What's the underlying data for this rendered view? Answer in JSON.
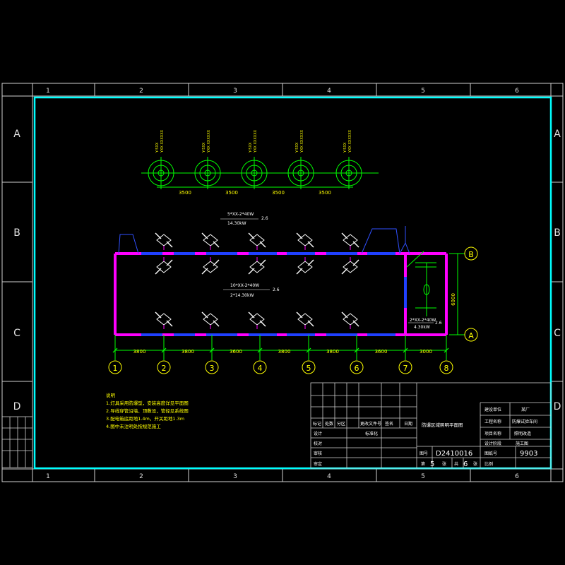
{
  "frame": {
    "columns": [
      "1",
      "2",
      "3",
      "4",
      "5",
      "6"
    ],
    "rows": [
      "A",
      "B",
      "C",
      "D"
    ]
  },
  "lamps": {
    "labels": [
      "Y-5XX",
      "Y-5XX",
      "Y-5XX",
      "Y-5XX",
      "Y-5XX"
    ],
    "sublabel": "YXX XXXXXX",
    "spacings": [
      "3500",
      "3500",
      "3500",
      "3500"
    ]
  },
  "circuits": [
    {
      "text": "5*XX-2*40W",
      "tag": "2.6",
      "power": "14.30kW"
    },
    {
      "text": "10*XX-2*40W",
      "tag": "2.6",
      "power": "2*14.30kW"
    },
    {
      "text": "2*XX-2*40W",
      "tag": "2.6",
      "power": "4.30kW"
    }
  ],
  "grid": {
    "spacings": [
      "3800",
      "3800",
      "3600",
      "3800",
      "3800",
      "3600",
      "3000"
    ],
    "axis_numbers": [
      "1",
      "2",
      "3",
      "4",
      "5",
      "6",
      "7",
      "8"
    ],
    "axis_letters": [
      "B",
      "A"
    ],
    "depth": "6000"
  },
  "notes": {
    "title": "说明",
    "lines": [
      "1.灯具采用防爆型，安装高度详见平面图",
      "2.导线穿管沿墙、顶敷设，管径见系统图",
      "3.配电箱底距地1.4m，开关距地1.3m",
      "4.图中未注明处按规范施工"
    ]
  },
  "title_block": {
    "drawing_title": "防爆区域照明平面图",
    "drawing_no_label": "图号",
    "drawing_no": "D2410016",
    "sheet_label_a": "第",
    "sheet_no": "5",
    "sheet_label_b": "张",
    "sheet_label_c": "共",
    "sheet_total": "6",
    "sheet_label_d": "张",
    "code_label": "图纸号",
    "code": "9903",
    "scale_label": "比例",
    "right_rows": [
      {
        "label": "建设单位",
        "value": "某厂"
      },
      {
        "label": "工程名称",
        "value": "防爆试验车间"
      },
      {
        "label": "项目名称",
        "value": "照明改造"
      },
      {
        "label": "设计阶段",
        "value": "施工图"
      }
    ],
    "rev_headers": [
      "标记",
      "处数",
      "分区",
      "更改文件号",
      "签名",
      "日期"
    ],
    "sign_rows": [
      "设计",
      "校对",
      "审核",
      "审定"
    ],
    "std_label": "标准化"
  }
}
